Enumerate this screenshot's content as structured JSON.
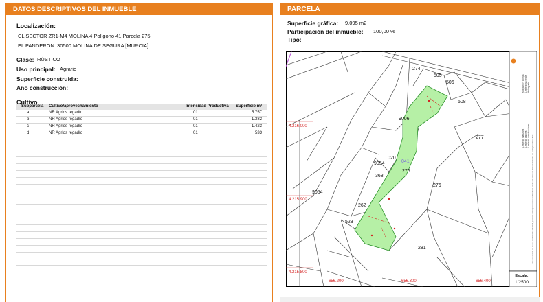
{
  "left_panel": {
    "header": "DATOS DESCRIPTIVOS DEL INMUEBLE",
    "localizacion_label": "Localización:",
    "address_line1": "CL SECTOR ZR1-M4 MOLINA 4  Polígono 41 Parcela 275",
    "address_line2": "EL PANDERON. 30500 MOLINA DE SEGURA [MURCIA]",
    "clase_label": "Clase:",
    "clase_value": "RÚSTICO",
    "uso_label": "Uso principal:",
    "uso_value": "Agrario",
    "superficie_label": "Superficie construida:",
    "ano_label": "Año construcción:",
    "cultivo_title": "Cultivo",
    "cultivo_headers": [
      "Subparcela",
      "Cultivo/aprovechamiento",
      "Intensidad Productiva",
      "Superficie m²"
    ],
    "cultivo_rows": [
      {
        "sub": "a",
        "cultivo": "NR Agrios regadío",
        "intensidad": "01",
        "superficie": "5.757"
      },
      {
        "sub": "b",
        "cultivo": "NR Agrios regadío",
        "intensidad": "01",
        "superficie": "1.382"
      },
      {
        "sub": "c",
        "cultivo": "NR Agrios regadío",
        "intensidad": "01",
        "superficie": "1.423"
      },
      {
        "sub": "d",
        "cultivo": "NR Agrios regadío",
        "intensidad": "01",
        "superficie": "533"
      }
    ]
  },
  "right_panel": {
    "header": "PARCELA",
    "sup_grafica_label": "Superficie gráfica:",
    "sup_grafica_value": "9.095 m2",
    "participacion_label": "Participación del inmueble:",
    "participacion_value": "100,00 %",
    "tipo_label": "Tipo:"
  },
  "map": {
    "parcel_numbers": [
      "274",
      "505",
      "506",
      "508",
      "9006",
      "277",
      "020",
      "041",
      "9054",
      "275",
      "368",
      "276",
      "9054",
      "262",
      "523",
      "281"
    ],
    "coords_y": [
      "4.216.000",
      "4.215.900",
      "4.215.800"
    ],
    "coords_x": [
      "656.200",
      "656.300",
      "656.400"
    ],
    "escala_label": "Escala:",
    "escala_value": "1/2500",
    "legend_lines": [
      "Límite de manzana",
      "Límite de parcela",
      "Límite de construcciones",
      "Mobiliario y aceras",
      "Límite zona verde",
      "Hidrografía"
    ],
    "legend_note": "Este documento no es una certificación catastral, pero sus datos pueden ser verificados a través del Acceso a datos catastrales no protegidos de la SEC"
  },
  "colors": {
    "accent": "#e8801f",
    "parcel_fill": "#b6f0a6",
    "coord_red": "#d42020"
  }
}
